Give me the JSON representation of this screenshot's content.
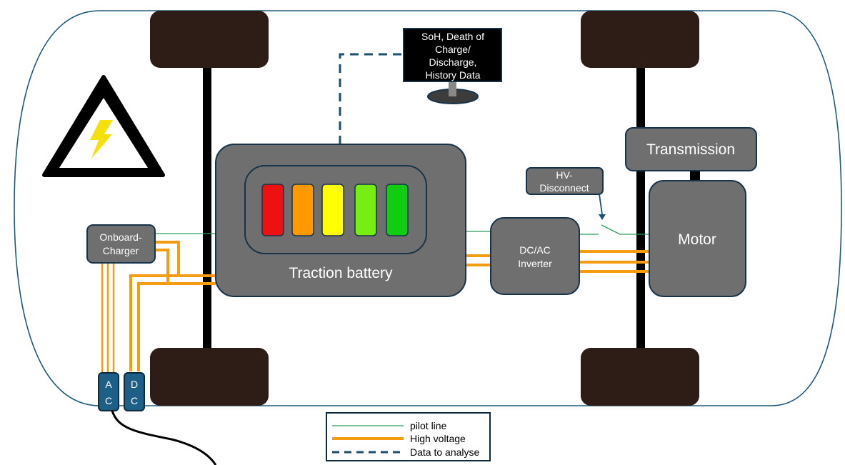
{
  "components": {
    "monitor_text": [
      "SoH, Death of",
      "Charge/",
      "Discharge,",
      "History Data"
    ],
    "battery_label": "Traction battery",
    "charger_label": [
      "Onboard-",
      "Charger"
    ],
    "inverter_label": [
      "DC/AC",
      "Inverter"
    ],
    "hv_disconnect_label": [
      "HV-",
      "Disconnect"
    ],
    "transmission_label": "Transmission",
    "motor_label": "Motor",
    "ac_port": [
      "A",
      "C"
    ],
    "dc_port": [
      "D",
      "C"
    ]
  },
  "battery_cells": [
    "#ee1111",
    "#ff9900",
    "#ffff00",
    "#77ee11",
    "#11cc11"
  ],
  "legend": {
    "pilot": "pilot line",
    "high_voltage": "High voltage",
    "data": "Data to analyse"
  },
  "colors": {
    "pilot_line": "#2a9a5a",
    "high_voltage": "#f59c12",
    "data_line": "#1d4f6e",
    "warning_symbol": "#f5e00a"
  }
}
